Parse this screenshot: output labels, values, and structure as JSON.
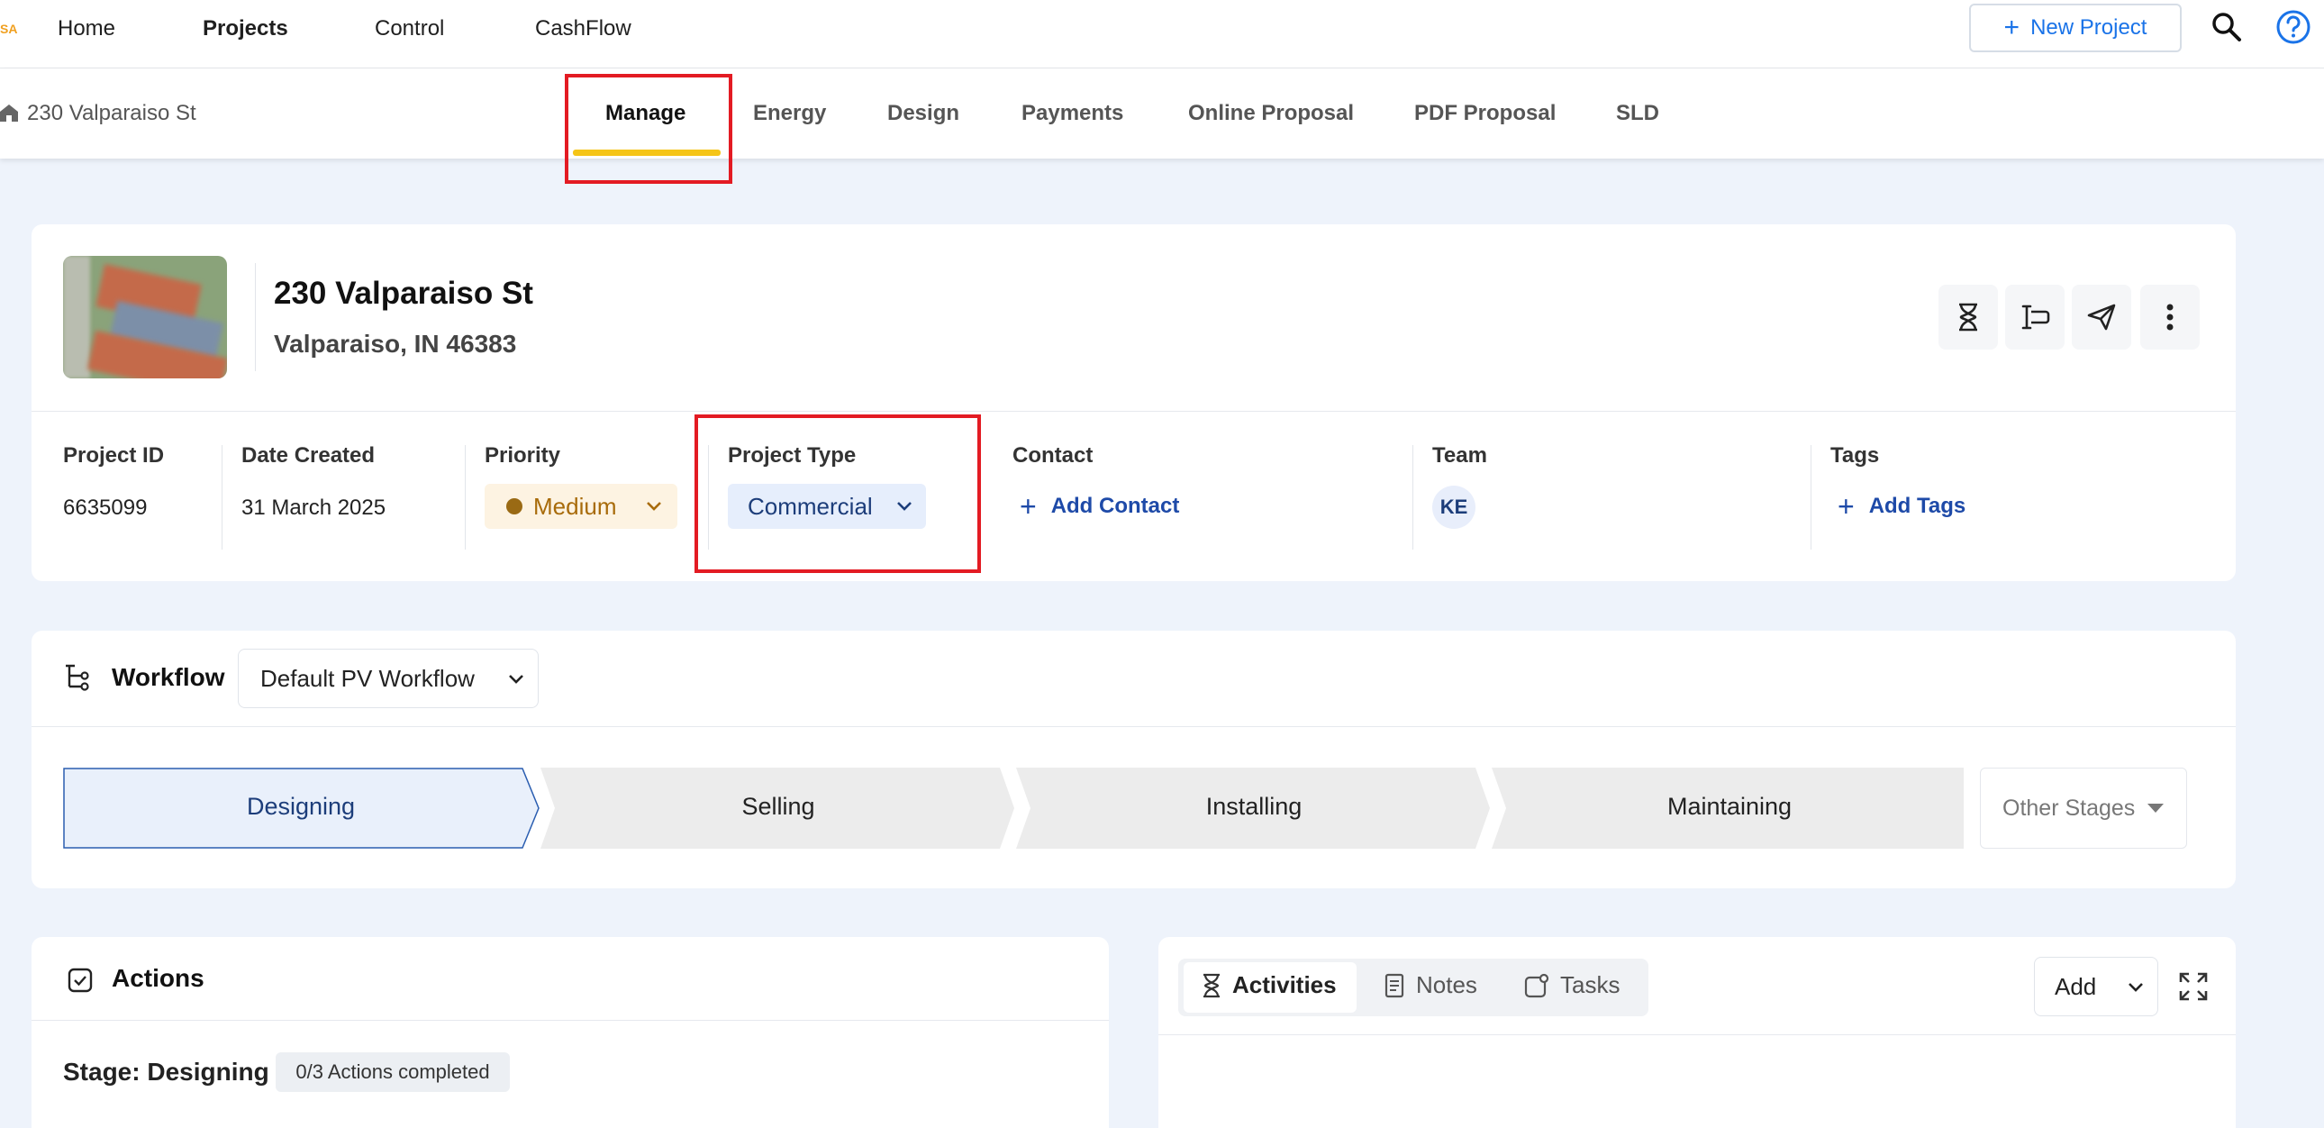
{
  "topnav": {
    "logo_fragment": "SA",
    "items": [
      {
        "label": "Home"
      },
      {
        "label": "Projects"
      },
      {
        "label": "Control"
      },
      {
        "label": "CashFlow"
      }
    ],
    "new_project_label": "New Project"
  },
  "subnav": {
    "breadcrumb": "230 Valparaiso St",
    "tabs": [
      {
        "label": "Manage"
      },
      {
        "label": "Energy"
      },
      {
        "label": "Design"
      },
      {
        "label": "Payments"
      },
      {
        "label": "Online Proposal"
      },
      {
        "label": "PDF Proposal"
      },
      {
        "label": "SLD"
      }
    ]
  },
  "project": {
    "title": "230 Valparaiso St",
    "address": "Valparaiso, IN 46383",
    "fields": {
      "project_id_label": "Project ID",
      "project_id": "6635099",
      "date_created_label": "Date Created",
      "date_created": "31 March 2025",
      "priority_label": "Priority",
      "priority": "Medium",
      "project_type_label": "Project Type",
      "project_type": "Commercial",
      "contact_label": "Contact",
      "add_contact": "Add Contact",
      "team_label": "Team",
      "team_initials": "KE",
      "tags_label": "Tags",
      "add_tags": "Add Tags"
    },
    "colors": {
      "priority_dot": "#9a6a14",
      "highlight": "#e31b23",
      "tab_underline": "#f5c518"
    }
  },
  "workflow": {
    "label": "Workflow",
    "selected": "Default PV Workflow",
    "stages": [
      {
        "label": "Designing"
      },
      {
        "label": "Selling"
      },
      {
        "label": "Installing"
      },
      {
        "label": "Maintaining"
      }
    ],
    "other_stages": "Other Stages"
  },
  "actions": {
    "label": "Actions",
    "stage_title": "Stage: Designing",
    "badge": "0/3 Actions completed"
  },
  "activity_panel": {
    "tabs": [
      {
        "label": "Activities"
      },
      {
        "label": "Notes"
      },
      {
        "label": "Tasks"
      }
    ],
    "add_label": "Add"
  }
}
